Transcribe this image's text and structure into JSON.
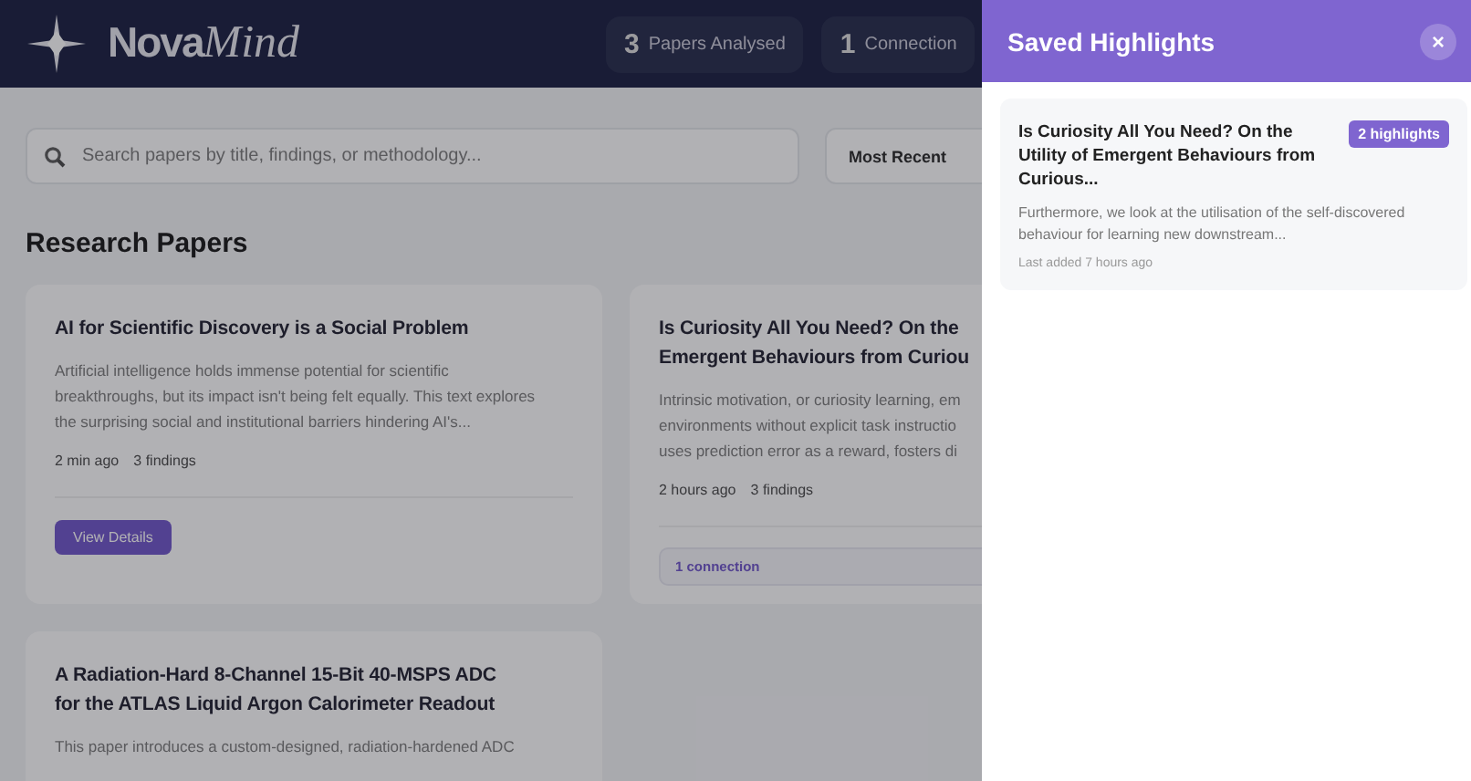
{
  "header": {
    "logo": {
      "bold": "Nova",
      "italic": "Mind"
    },
    "stats": [
      {
        "value": "3",
        "label": "Papers Analysed"
      },
      {
        "value": "1",
        "label": "Connection"
      }
    ]
  },
  "search": {
    "placeholder": "Search papers by title, findings, or methodology..."
  },
  "sort": {
    "value": "Most Recent"
  },
  "section_title": "Research Papers",
  "papers": [
    {
      "title_lines": [
        "AI for Scientific Discovery is a Social Problem"
      ],
      "summary_lines": [
        "Artificial intelligence holds immense potential for scientific",
        "breakthroughs, but its impact isn't being felt equally. This text explores",
        "the surprising social and institutional barriers hindering AI's..."
      ],
      "time": "2 min ago",
      "findings": "3 findings",
      "action": {
        "kind": "button",
        "label": "View Details"
      }
    },
    {
      "title_lines": [
        "Is Curiosity All You Need? On the",
        "Emergent Behaviours from Curiou"
      ],
      "summary_lines": [
        "Intrinsic motivation, or curiosity learning, em",
        "environments without explicit task instructio",
        "uses prediction error as a reward, fosters di"
      ],
      "time": "2 hours ago",
      "findings": "3 findings",
      "action": {
        "kind": "connection",
        "label": "1 connection"
      }
    },
    {
      "title_lines": [
        "A Radiation-Hard 8-Channel 15-Bit 40-MSPS ADC",
        "for the ATLAS Liquid Argon Calorimeter Readout"
      ],
      "summary_lines": [
        "This paper introduces a custom-designed, radiation-hardened ADC"
      ]
    }
  ],
  "panel": {
    "title": "Saved Highlights",
    "close": "×",
    "highlights": [
      {
        "title": "Is Curiosity All You Need? On the Utility of Emergent Behaviours from Curious...",
        "badge": "2 highlights",
        "excerpt": "Furthermore, we look at the utilisation of the self-discovered behaviour for learning new downstream...",
        "meta": "Last added 7 hours ago"
      }
    ]
  }
}
